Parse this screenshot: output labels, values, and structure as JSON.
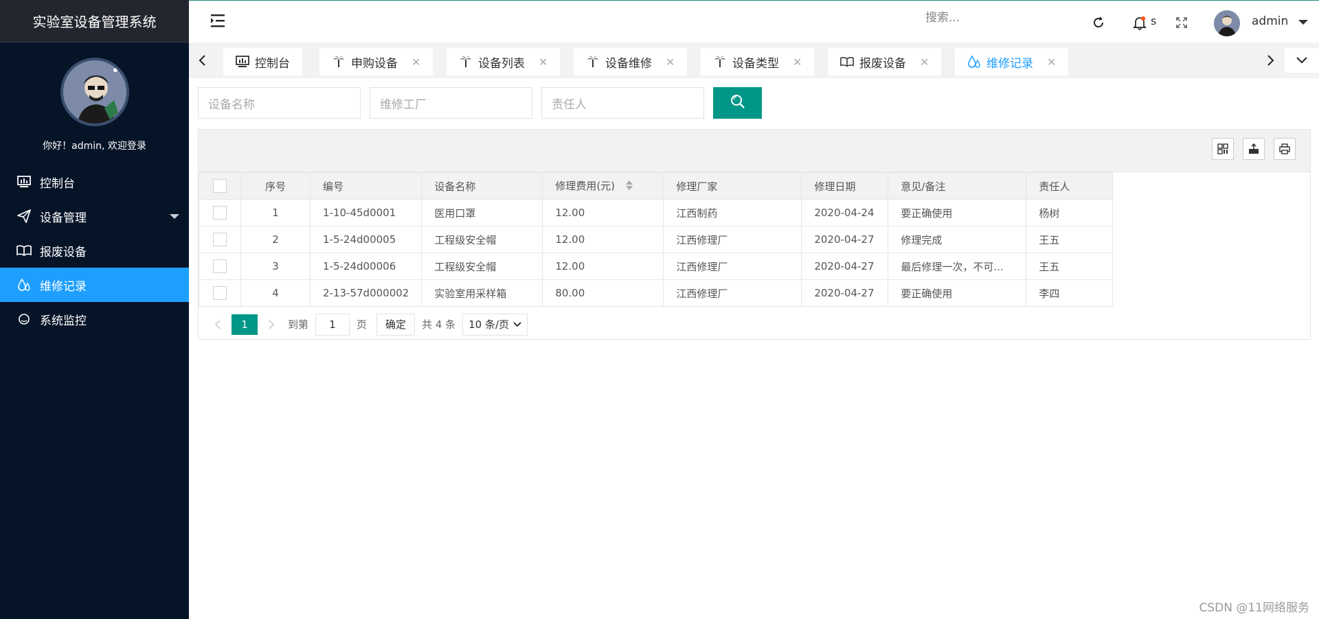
{
  "sidebar": {
    "brand": "实验室设备管理系统",
    "welcome": "你好！admin, 欢迎登录",
    "items": [
      {
        "label": "控制台",
        "icon": "monitor-icon"
      },
      {
        "label": "设备管理",
        "icon": "paper-plane-icon"
      },
      {
        "label": "报废设备",
        "icon": "book-icon"
      },
      {
        "label": "维修记录",
        "icon": "drops-icon"
      },
      {
        "label": "系统监控",
        "icon": "circle-icon"
      }
    ],
    "active_index": 3
  },
  "header": {
    "search_placeholder": "搜索...",
    "notify_label": "s",
    "username": "admin"
  },
  "tabs": [
    {
      "label": "控制台",
      "icon": "monitor-icon",
      "closable": false
    },
    {
      "label": "申购设备",
      "icon": "palm-tree-icon",
      "closable": true
    },
    {
      "label": "设备列表",
      "icon": "palm-tree-icon",
      "closable": true
    },
    {
      "label": "设备维修",
      "icon": "palm-tree-icon",
      "closable": true
    },
    {
      "label": "设备类型",
      "icon": "palm-tree-icon",
      "closable": true
    },
    {
      "label": "报废设备",
      "icon": "book-icon",
      "closable": true
    },
    {
      "label": "维修记录",
      "icon": "drops-icon",
      "closable": true,
      "active": true
    }
  ],
  "filters": {
    "device_name_placeholder": "设备名称",
    "factory_placeholder": "维修工厂",
    "owner_placeholder": "责任人"
  },
  "table": {
    "columns": [
      "序号",
      "编号",
      "设备名称",
      "修理费用(元)",
      "修理厂家",
      "修理日期",
      "意见/备注",
      "责任人"
    ],
    "rows": [
      [
        "1",
        "1-10-45d0001",
        "医用口罩",
        "12.00",
        "江西制药",
        "2020-04-24",
        "要正确使用",
        "杨树"
      ],
      [
        "2",
        "1-5-24d00005",
        "工程级安全帽",
        "12.00",
        "江西修理厂",
        "2020-04-27",
        "修理完成",
        "王五"
      ],
      [
        "3",
        "1-5-24d00006",
        "工程级安全帽",
        "12.00",
        "江西修理厂",
        "2020-04-27",
        "最后修理一次，不可...",
        "王五"
      ],
      [
        "4",
        "2-13-57d000002",
        "实验室用采样箱",
        "80.00",
        "江西修理厂",
        "2020-04-27",
        "要正确使用",
        "李四"
      ]
    ]
  },
  "pager": {
    "current": "1",
    "goto_label": "到第",
    "page_input": "1",
    "page_unit": "页",
    "confirm": "确定",
    "total": "共 4 条",
    "page_size": "10 条/页"
  },
  "colors": {
    "sidebar_bg": "#061428",
    "active_blue": "#1e9fff",
    "primary_green": "#009688"
  },
  "watermark": "CSDN @11网络服务"
}
